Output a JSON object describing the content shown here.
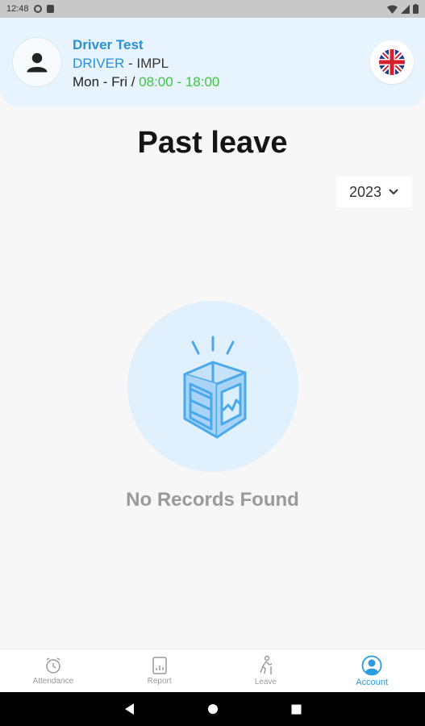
{
  "status_bar": {
    "time": "12:48"
  },
  "header": {
    "name": "Driver Test",
    "role": "DRIVER",
    "separator": " - ",
    "company": "IMPL",
    "days": "Mon - Fri / ",
    "hours": "08:00 - 18:00"
  },
  "page": {
    "title": "Past leave",
    "year": "2023",
    "empty_message": "No Records Found"
  },
  "nav": {
    "items": [
      {
        "label": "Attendance",
        "icon": "alarm-clock-icon",
        "active": false
      },
      {
        "label": "Report",
        "icon": "report-doc-icon",
        "active": false
      },
      {
        "label": "Leave",
        "icon": "walking-person-icon",
        "active": false
      },
      {
        "label": "Account",
        "icon": "account-circle-icon",
        "active": true
      }
    ]
  },
  "colors": {
    "accent": "#2b9be0",
    "name_blue": "#2b8fd6",
    "hours_green": "#3ec63e",
    "header_bg": "#e8f4fd",
    "empty_circle": "#e0f0fc"
  }
}
